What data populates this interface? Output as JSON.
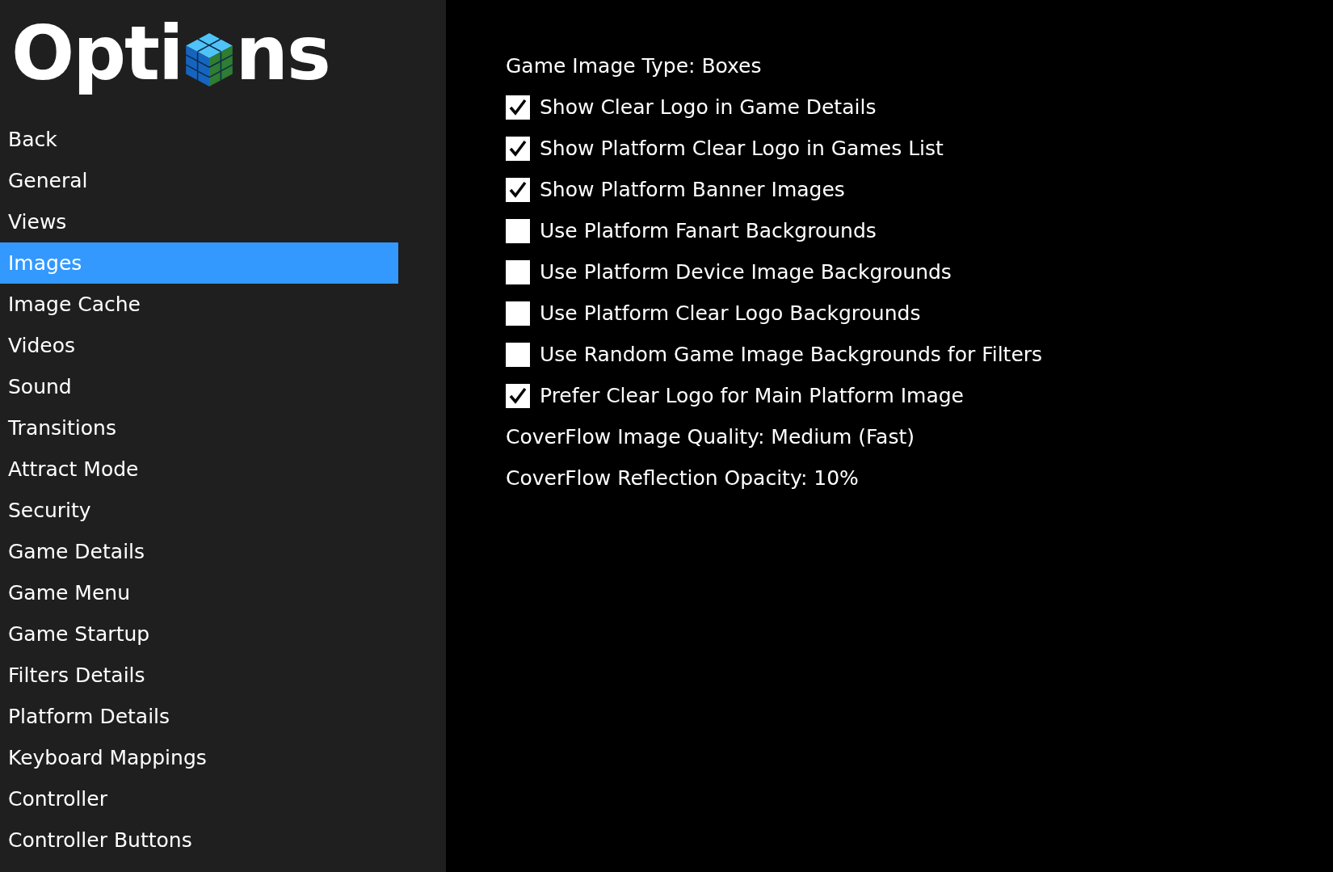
{
  "logo": {
    "text_before": "Opti",
    "text_after": "ns"
  },
  "sidebar": {
    "items": [
      {
        "label": "Back",
        "selected": false
      },
      {
        "label": "General",
        "selected": false
      },
      {
        "label": "Views",
        "selected": false
      },
      {
        "label": "Images",
        "selected": true
      },
      {
        "label": "Image Cache",
        "selected": false
      },
      {
        "label": "Videos",
        "selected": false
      },
      {
        "label": "Sound",
        "selected": false
      },
      {
        "label": "Transitions",
        "selected": false
      },
      {
        "label": "Attract Mode",
        "selected": false
      },
      {
        "label": "Security",
        "selected": false
      },
      {
        "label": "Game Details",
        "selected": false
      },
      {
        "label": "Game Menu",
        "selected": false
      },
      {
        "label": "Game Startup",
        "selected": false
      },
      {
        "label": "Filters Details",
        "selected": false
      },
      {
        "label": "Platform Details",
        "selected": false
      },
      {
        "label": "Keyboard Mappings",
        "selected": false
      },
      {
        "label": "Controller",
        "selected": false
      },
      {
        "label": "Controller Buttons",
        "selected": false
      }
    ]
  },
  "options": [
    {
      "kind": "value",
      "label": "Game Image Type: Boxes"
    },
    {
      "kind": "checkbox",
      "label": "Show Clear Logo in Game Details",
      "checked": true
    },
    {
      "kind": "checkbox",
      "label": "Show Platform Clear Logo in Games List",
      "checked": true
    },
    {
      "kind": "checkbox",
      "label": "Show Platform Banner Images",
      "checked": true
    },
    {
      "kind": "checkbox",
      "label": "Use Platform Fanart Backgrounds",
      "checked": false
    },
    {
      "kind": "checkbox",
      "label": "Use Platform Device Image Backgrounds",
      "checked": false
    },
    {
      "kind": "checkbox",
      "label": "Use Platform Clear Logo Backgrounds",
      "checked": false
    },
    {
      "kind": "checkbox",
      "label": "Use Random Game Image Backgrounds for Filters",
      "checked": false
    },
    {
      "kind": "checkbox",
      "label": "Prefer Clear Logo for Main Platform Image",
      "checked": true
    },
    {
      "kind": "value",
      "label": "CoverFlow Image Quality: Medium (Fast)"
    },
    {
      "kind": "value",
      "label": "CoverFlow Reflection Opacity: 10%"
    }
  ]
}
